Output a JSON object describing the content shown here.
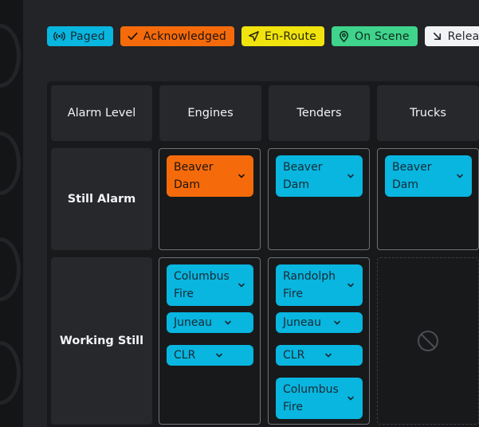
{
  "legend": [
    {
      "label": "Paged",
      "icon": "broadcast-icon",
      "color": "#08b6e0"
    },
    {
      "label": "Acknowledged",
      "icon": "check-icon",
      "color": "#f56b0c"
    },
    {
      "label": "En-Route",
      "icon": "navigation-arrow-icon",
      "color": "#f0e30e"
    },
    {
      "label": "On Scene",
      "icon": "map-pin-icon",
      "color": "#3fd38c"
    },
    {
      "label": "Released",
      "icon": "arrow-down-right-icon",
      "color": "#f2f3f5"
    }
  ],
  "board": {
    "columns": [
      "Alarm Level",
      "Engines",
      "Tenders",
      "Trucks"
    ],
    "rows": [
      {
        "label": "Still Alarm",
        "engines": [
          {
            "name": "Beaver Dam",
            "status": "acknowledged"
          }
        ],
        "tenders": [
          {
            "name": "Beaver Dam",
            "status": "paged"
          }
        ],
        "trucks": [
          {
            "name": "Beaver Dam",
            "status": "paged"
          }
        ]
      },
      {
        "label": "Working Still",
        "engines": [
          {
            "name": "Columbus Fire",
            "status": "paged"
          },
          {
            "name": "Juneau",
            "status": "paged"
          },
          {
            "name": "CLR",
            "status": "paged"
          }
        ],
        "tenders": [
          {
            "name": "Randolph Fire",
            "status": "paged"
          },
          {
            "name": "Juneau",
            "status": "paged"
          },
          {
            "name": "CLR",
            "status": "paged"
          },
          {
            "name": "Columbus Fire",
            "status": "paged"
          }
        ],
        "trucks_icon": "blocked-icon"
      }
    ]
  }
}
